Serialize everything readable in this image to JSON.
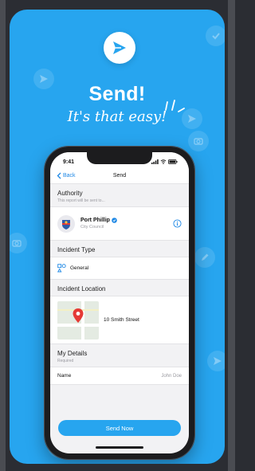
{
  "promo": {
    "headline": "Send!",
    "tagline": "It's that easy!"
  },
  "status_bar": {
    "time": "9:41"
  },
  "nav": {
    "back_label": "Back",
    "title": "Send"
  },
  "authority": {
    "title": "Authority",
    "subtitle": "This report will be sent to...",
    "name": "Port Phillip",
    "type": "City Council"
  },
  "incident_type": {
    "title": "Incident Type",
    "value": "General"
  },
  "incident_location": {
    "title": "Incident Location",
    "address": "10 Smith Street"
  },
  "my_details": {
    "title": "My Details",
    "subtitle": "Required",
    "name_label": "Name",
    "name_value": "John Doe"
  },
  "send_button_label": "Send Now",
  "colors": {
    "brand_blue": "#27a5ef",
    "ios_blue": "#1e88e5",
    "pin_red": "#e53935"
  }
}
